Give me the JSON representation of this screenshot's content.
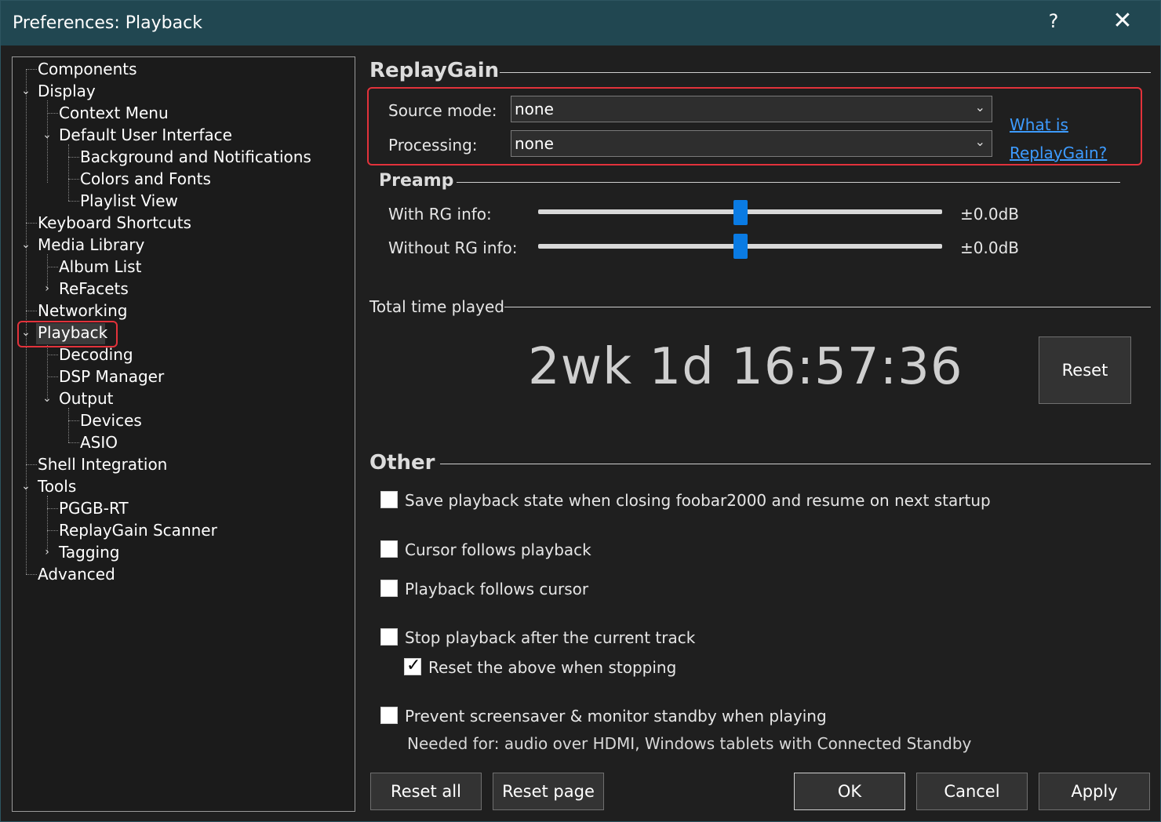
{
  "window": {
    "title": "Preferences: Playback",
    "help_glyph": "?",
    "close_glyph": "✕"
  },
  "tree": {
    "items": [
      "Components",
      "Display",
      "Context Menu",
      "Default User Interface",
      "Background and Notifications",
      "Colors and Fonts",
      "Playlist View",
      "Keyboard Shortcuts",
      "Media Library",
      "Album List",
      "ReFacets",
      "Networking",
      "Playback",
      "Decoding",
      "DSP Manager",
      "Output",
      "Devices",
      "ASIO",
      "Shell Integration",
      "Tools",
      "PGGB-RT",
      "ReplayGain Scanner",
      "Tagging",
      "Advanced"
    ],
    "selected": "Playback"
  },
  "replaygain": {
    "header": "ReplayGain",
    "source_mode_label": "Source mode:",
    "source_mode_value": "none",
    "processing_label": "Processing:",
    "processing_value": "none",
    "link_line1": "What is",
    "link_line2": "ReplayGain?"
  },
  "preamp": {
    "header": "Preamp",
    "with_label": "With RG info:",
    "with_value": "±0.0dB",
    "with_level": 0.5,
    "without_label": "Without RG info:",
    "without_value": "±0.0dB",
    "without_level": 0.5
  },
  "total_time": {
    "header": "Total time played",
    "value": "2wk 1d 16:57:36",
    "reset_label": "Reset"
  },
  "other": {
    "header": "Other",
    "save_state": {
      "label": "Save playback state when closing foobar2000 and resume on next startup",
      "checked": false
    },
    "cursor_follows": {
      "label": "Cursor follows playback",
      "checked": false
    },
    "playback_follows": {
      "label": "Playback follows cursor",
      "checked": false
    },
    "stop_after": {
      "label": "Stop playback after the current track",
      "checked": false
    },
    "reset_above": {
      "label": "Reset the above when stopping",
      "checked": true
    },
    "prevent_screensaver": {
      "label": "Prevent screensaver & monitor standby when playing",
      "checked": false
    },
    "note": "Needed for: audio over HDMI, Windows tablets with Connected Standby"
  },
  "buttons": {
    "reset_all": "Reset all",
    "reset_page": "Reset page",
    "ok": "OK",
    "cancel": "Cancel",
    "apply": "Apply"
  },
  "colors": {
    "accent": "#0a7be3",
    "highlight": "#e2323b",
    "link": "#3d9bff",
    "titlebar": "#214751"
  }
}
